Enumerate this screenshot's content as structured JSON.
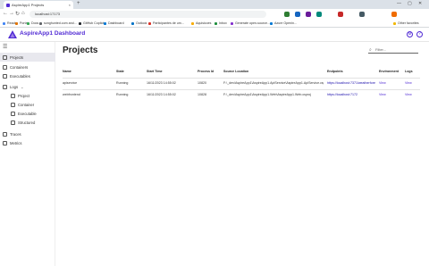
{
  "browser": {
    "tab_title": "AspireApp1 Projects",
    "new_tab": "+",
    "url": "localhost:17173",
    "window_controls": [
      "—",
      "▢",
      "✕"
    ],
    "tab_close": "×",
    "nav": {
      "back": "←",
      "forward": "→",
      "reload": "↻",
      "home": "⌂"
    },
    "extension_colors": [
      "#2e7d32",
      "#1565c0",
      "#6a1b9a",
      "#00897b",
      "#c62828",
      "#455a64",
      "#ef6c00"
    ],
    "bookmarks": [
      {
        "label": "Reader",
        "color": "#4285f4"
      },
      {
        "label": "Portal",
        "color": "#e37400"
      },
      {
        "label": "Docs",
        "color": "#34a853"
      },
      {
        "label": "songhunted.com and...",
        "color": "#5f6368"
      },
      {
        "label": "GitHub Copilot",
        "color": "#24292e"
      },
      {
        "label": "Dashboard",
        "color": "#0078d4"
      },
      {
        "label": "Outlook",
        "color": "#0072c6"
      },
      {
        "label": "Participantes de um...",
        "color": "#d93025"
      },
      {
        "label": "Aquisicoes",
        "color": "#f9ab00"
      },
      {
        "label": "Inbox",
        "color": "#1e8e3e"
      },
      {
        "label": "Generate open-source...",
        "color": "#8430ce"
      },
      {
        "label": "Azure Openin...",
        "color": "#0078d4"
      },
      {
        "label": "Other favorites",
        "color": "#f2b600"
      }
    ]
  },
  "app": {
    "title": "AspireApp1 Dashboard",
    "header_icons": [
      "settings-icon",
      "help-icon"
    ]
  },
  "sidebar": {
    "items": [
      {
        "label": "Projects",
        "selected": true,
        "sub": false
      },
      {
        "label": "Containers",
        "selected": false,
        "sub": false
      },
      {
        "label": "Executables",
        "selected": false,
        "sub": false
      },
      {
        "label": "Logs",
        "selected": false,
        "sub": false,
        "chevron": "⌄"
      },
      {
        "label": "Project",
        "selected": false,
        "sub": true
      },
      {
        "label": "Container",
        "selected": false,
        "sub": true
      },
      {
        "label": "Executable",
        "selected": false,
        "sub": true
      },
      {
        "label": "Structured",
        "selected": false,
        "sub": true
      },
      {
        "label": "Traces",
        "selected": false,
        "sub": false
      },
      {
        "label": "Metrics",
        "selected": false,
        "sub": false
      }
    ]
  },
  "main": {
    "title": "Projects",
    "filter_placeholder": "Filter..."
  },
  "table": {
    "columns": [
      "Name",
      "State",
      "Start Time",
      "Process Id",
      "Source Location",
      "Endpoints",
      "Environment",
      "Logs"
    ],
    "rows": [
      {
        "name": "apiservice",
        "state": "Running",
        "start_time": "16/11/2023 14:55:02",
        "process_id": "10820",
        "source": "F:\\_dev\\AspireApp1\\AspireApp1.ApiService\\AspireApp1.ApiService.csproj",
        "endpoint": "https://localhost:7371/weatherforecast",
        "environment": "View",
        "logs": "View"
      },
      {
        "name": "webfrontend",
        "state": "Running",
        "start_time": "16/11/2023 14:55:02",
        "process_id": "10828",
        "source": "F:\\_dev\\AspireApp1\\AspireApp1.Web\\AspireApp1.Web.csproj",
        "endpoint": "https://localhost:7172",
        "environment": "View",
        "logs": "View"
      }
    ]
  }
}
